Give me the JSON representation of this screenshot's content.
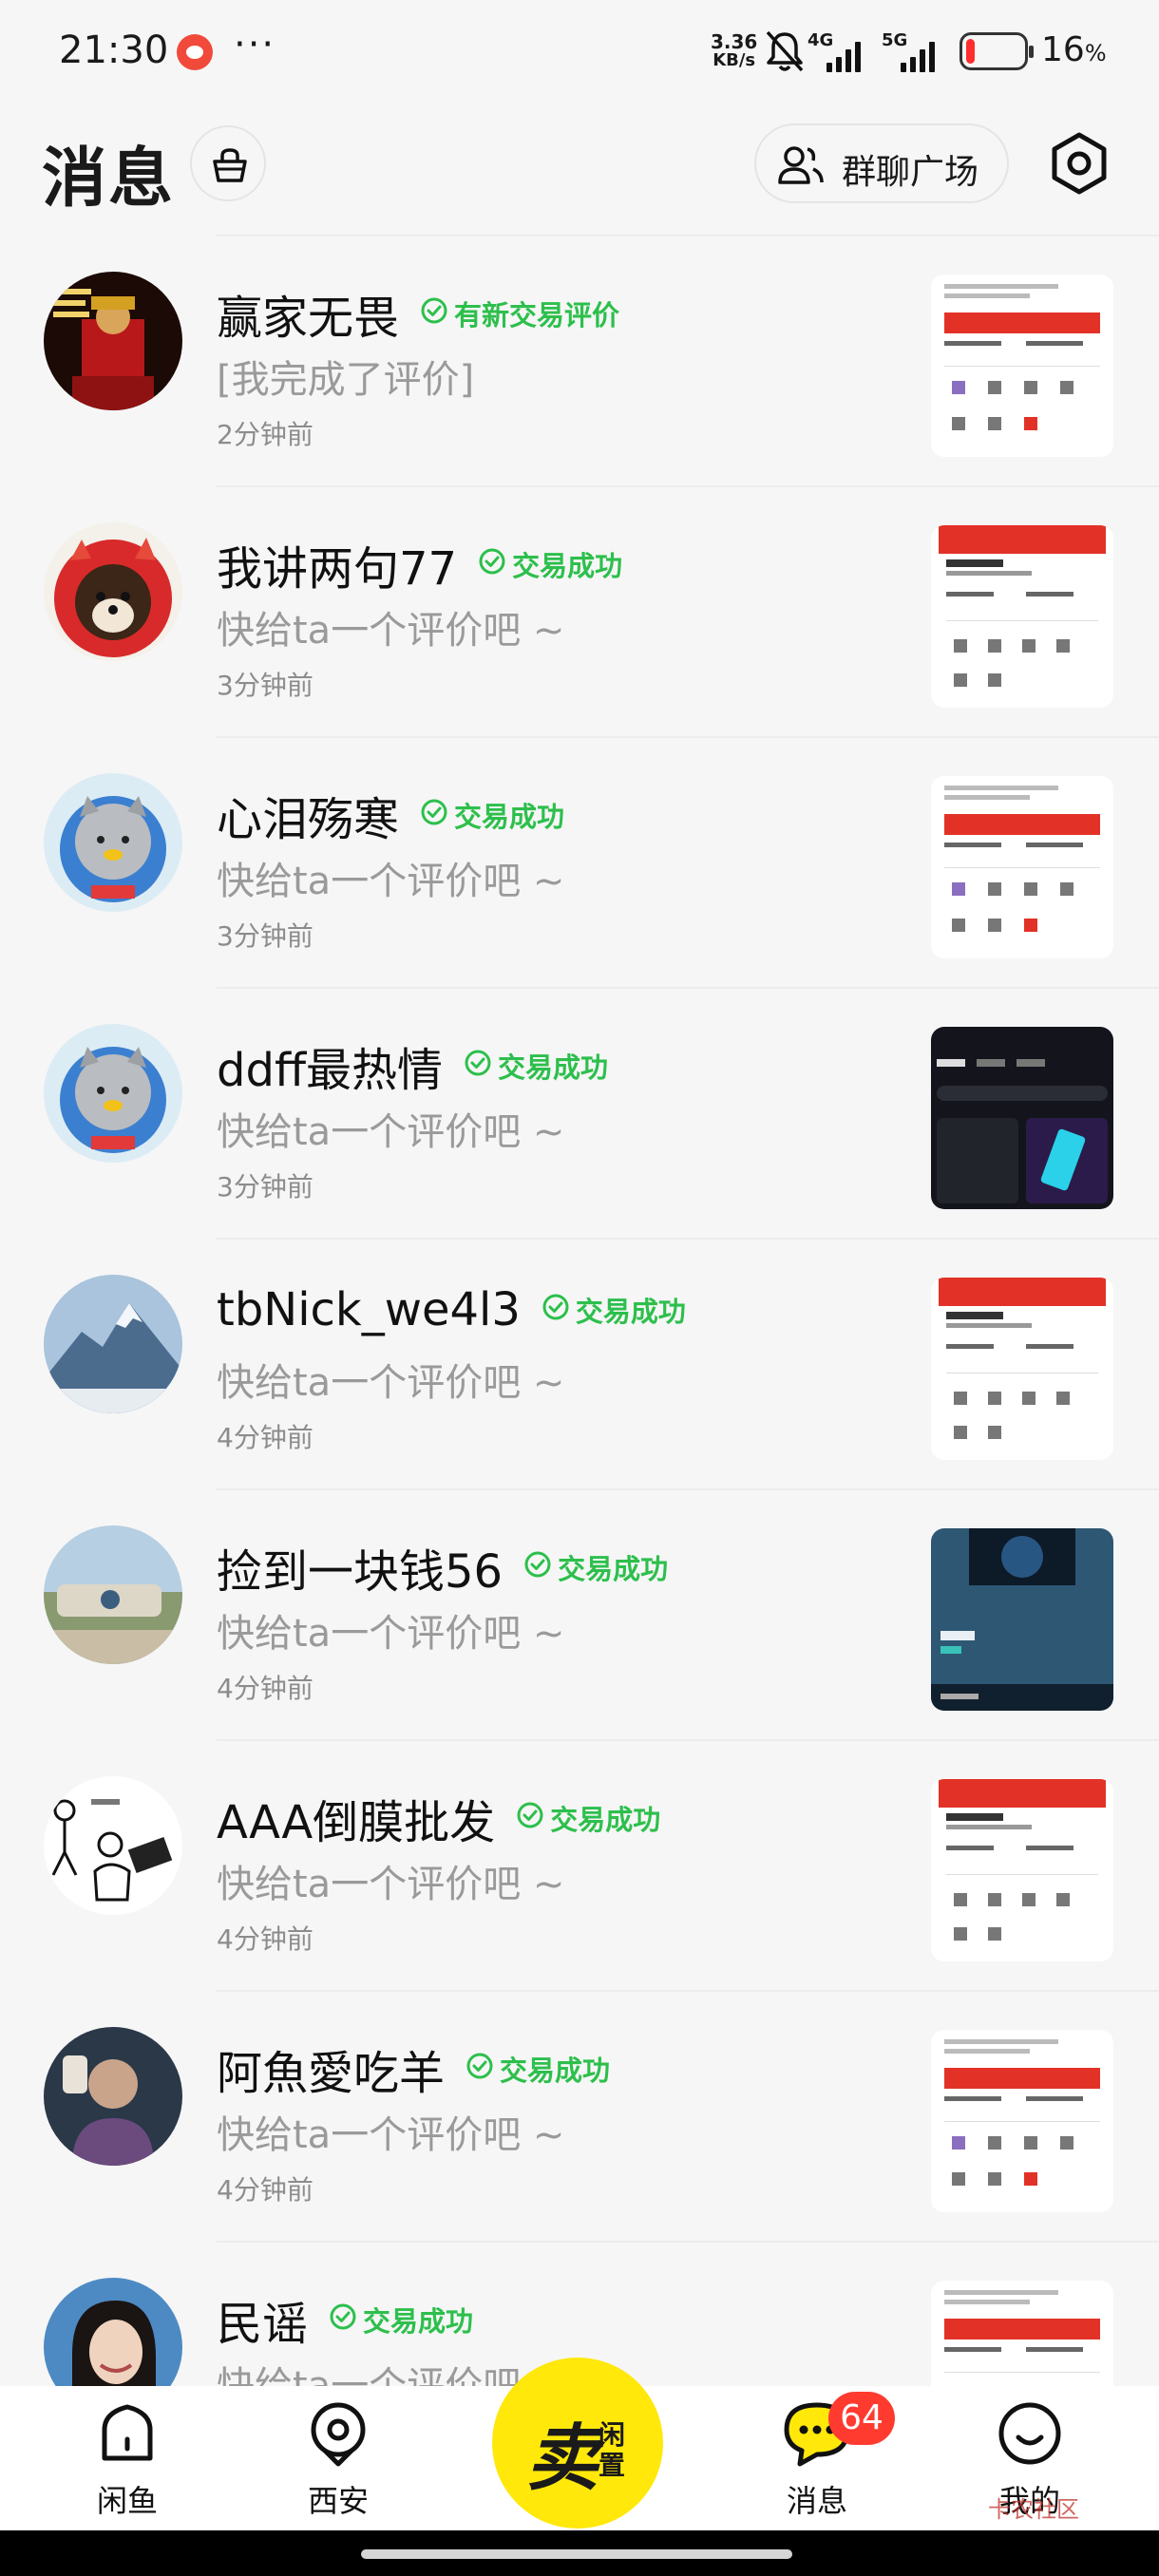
{
  "status_bar": {
    "time": "21:30",
    "more": "···",
    "speed_value": "3.36",
    "speed_unit": "KB/s",
    "network1": "4G",
    "network2": "5G",
    "battery_level": 16,
    "battery_pct": "16",
    "battery_unit": "%"
  },
  "header": {
    "title": "消息",
    "group_chat_label": "群聊广场"
  },
  "conversations": [
    {
      "name": "赢家无畏",
      "badge": "有新交易评价",
      "preview": "[我完成了评价]",
      "time": "2分钟前",
      "avatar": "figure-red-avatar",
      "thumb": "white-screenshot"
    },
    {
      "name": "我讲两句77",
      "badge": "交易成功",
      "preview": "快给ta一个评价吧 ~",
      "time": "3分钟前",
      "avatar": "dog-red-hood-avatar",
      "thumb": "red-screenshot"
    },
    {
      "name": "心泪殇寒",
      "badge": "交易成功",
      "preview": "快给ta一个评价吧 ~",
      "time": "3分钟前",
      "avatar": "astronaut-cat-avatar",
      "thumb": "white-screenshot"
    },
    {
      "name": "ddff最热情",
      "badge": "交易成功",
      "preview": "快给ta一个评价吧 ~",
      "time": "3分钟前",
      "avatar": "astronaut-cat-avatar",
      "thumb": "dark-screenshot"
    },
    {
      "name": "tbNick_we4l3",
      "badge": "交易成功",
      "preview": "快给ta一个评价吧 ~",
      "time": "4分钟前",
      "avatar": "mountain-avatar",
      "thumb": "red-screenshot"
    },
    {
      "name": "捡到一块钱56",
      "badge": "交易成功",
      "preview": "快给ta一个评价吧 ~",
      "time": "4分钟前",
      "avatar": "landscape-avatar",
      "thumb": "blue-screenshot"
    },
    {
      "name": "AAA倒膜批发",
      "badge": "交易成功",
      "preview": "快给ta一个评价吧 ~",
      "time": "4分钟前",
      "avatar": "sketch-avatar",
      "thumb": "red-screenshot"
    },
    {
      "name": "阿魚愛吃羊",
      "badge": "交易成功",
      "preview": "快给ta一个评价吧 ~",
      "time": "4分钟前",
      "avatar": "person-avatar",
      "thumb": "white-screenshot"
    },
    {
      "name": "民谣",
      "badge": "交易成功",
      "preview": "快给ta一个评价吧 ~",
      "time": "",
      "avatar": "girl-avatar",
      "thumb": "white-screenshot"
    }
  ],
  "bottom_nav": {
    "home_label": "闲鱼",
    "location_label": "西安",
    "sell_main": "卖",
    "sell_sub1": "闲",
    "sell_sub2": "置",
    "messages_label": "消息",
    "messages_count": "64",
    "me_label": "我的"
  },
  "watermark": "卡农社区",
  "colors": {
    "accent_green": "#2dbf4c",
    "sell_yellow": "#ffe80a",
    "badge_red": "#ff3b30"
  }
}
